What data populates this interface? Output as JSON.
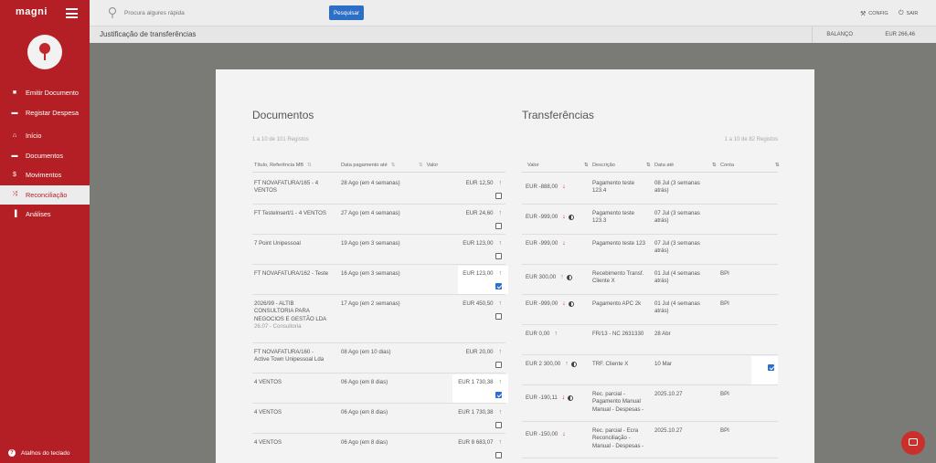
{
  "sidebar": {
    "brand": "magni",
    "groups": [
      {
        "items": [
          {
            "label": "Emitir Documento",
            "icon": "document-icon",
            "glyph": "■"
          },
          {
            "label": "Registar Despesa",
            "icon": "wallet-icon",
            "glyph": "▬"
          }
        ]
      },
      {
        "items": [
          {
            "label": "Início",
            "icon": "home-icon",
            "glyph": "⌂"
          },
          {
            "label": "Documentos",
            "icon": "folder-icon",
            "glyph": "▬"
          },
          {
            "label": "Movimentos",
            "icon": "dollar-icon",
            "glyph": "$"
          },
          {
            "label": "Reconciliação",
            "icon": "shuffle-icon",
            "glyph": "⤨",
            "active": true
          },
          {
            "label": "Análises",
            "icon": "bar-chart-icon",
            "glyph": "▐"
          }
        ]
      }
    ],
    "keyboard_shortcuts": "Atalhos do teclado"
  },
  "topbar": {
    "search_placeholder": "Procura algures rápida",
    "search_button": "Pesquisar",
    "config": "CONFIG",
    "logout": "SAIR"
  },
  "titlebar": {
    "title": "Justificação de transferências",
    "balance_label": "BALANÇO",
    "balance_value": "EUR 266,46"
  },
  "documents": {
    "title": "Documentos",
    "records": "1 a 10 de 101 Registos",
    "headers": [
      "Título, Referência MB",
      "Data pagamento até",
      "Valor"
    ],
    "rows": [
      {
        "title": [
          "FT NOVAFATURA/165 - 4",
          "VENTOS"
        ],
        "date": "28 Ago (em 4 semanas)",
        "value": "EUR 12,50",
        "checked": false
      },
      {
        "title": [
          "FT Testelnsert/1 - 4 VENTOS"
        ],
        "date": "27 Ago (em 4 semanas)",
        "value": "EUR 24,60",
        "checked": false
      },
      {
        "title": [
          "7 Point Unipessoal"
        ],
        "date": "19 Ago (em 3 semanas)",
        "value": "EUR 123,00",
        "checked": false
      },
      {
        "title": [
          "FT NOVAFATURA/162 - Teste"
        ],
        "date": "16 Ago (em 3 semanas)",
        "value": "EUR 123,00",
        "checked": true
      },
      {
        "title": [
          "2026/99 - ALTIB",
          "CONSULTORIA PARA",
          "NEGOCIOS E GESTÃO LDA",
          "26.07 - Consultoria"
        ],
        "date": "17 Ago (em 2 semanas)",
        "value": "EUR 450,50",
        "checked": false
      },
      {
        "title": [
          "FT NOVAFATURA/160 -",
          "Active Town Unipessoal Lda"
        ],
        "date": "08 Ago (em 10 dias)",
        "value": "EUR 20,00",
        "checked": false
      },
      {
        "title": [
          "4 VENTOS"
        ],
        "date": "06 Ago (em 8 dias)",
        "value": "EUR 1 730,38",
        "checked": true
      },
      {
        "title": [
          "4 VENTOS"
        ],
        "date": "06 Ago (em 8 dias)",
        "value": "EUR 1 730,38",
        "checked": false
      },
      {
        "title": [
          "4 VENTOS"
        ],
        "date": "06 Ago (em 8 dias)",
        "value": "EUR 8 683,07",
        "checked": false
      }
    ]
  },
  "transfers": {
    "title": "Transferências",
    "records": "1 a 10 de 82 Registos",
    "headers": [
      "Valor",
      "Descrição",
      "Data até",
      "Conta"
    ],
    "rows": [
      {
        "value": "EUR -888,00",
        "dir": "down",
        "half": false,
        "desc": [
          "Pagamento teste",
          "123.4"
        ],
        "date": [
          "08 Jul (3 semanas",
          "atrás)"
        ],
        "account": "",
        "checked": null
      },
      {
        "value": "EUR -999,00",
        "dir": "down",
        "half": true,
        "desc": [
          "Pagamento teste",
          "123.3"
        ],
        "date": [
          "07 Jul (3 semanas",
          "atrás)"
        ],
        "account": "",
        "checked": null
      },
      {
        "value": "EUR -999,00",
        "dir": "down",
        "half": false,
        "desc": [
          "Pagamento teste 123"
        ],
        "date": [
          "07 Jul (3 semanas",
          "atrás)"
        ],
        "account": "",
        "checked": null
      },
      {
        "value": "EUR 300,00",
        "dir": "up",
        "half": true,
        "desc": [
          "Recebimento Transf.",
          "Cliente X"
        ],
        "date": [
          "01 Jul (4 semanas",
          "atrás)"
        ],
        "account": "BPI",
        "checked": null
      },
      {
        "value": "EUR -999,00",
        "dir": "down",
        "half": true,
        "desc": [
          "Pagamento APC 2k"
        ],
        "date": [
          "01 Jul (4 semanas",
          "atrás)"
        ],
        "account": "BPI",
        "checked": null
      },
      {
        "value": "EUR 0,00",
        "dir": "up",
        "half": false,
        "desc": [
          "FR/13 - NC 2631330"
        ],
        "date": [
          "28 Abr"
        ],
        "account": "",
        "checked": null
      },
      {
        "value": "EUR 2 300,00",
        "dir": "up",
        "half": true,
        "desc": [
          "TRF. Cliente X"
        ],
        "date": [
          "10 Mar"
        ],
        "account": "",
        "checked": true
      },
      {
        "value": "EUR -190,11",
        "dir": "down",
        "half": true,
        "desc": [
          "Rec. parcial -",
          "Pagamento Manual",
          "Manual - Despesas -"
        ],
        "date": [
          "2025.10.27"
        ],
        "account": "BPI",
        "checked": null
      },
      {
        "value": "EUR -150,00",
        "dir": "down",
        "half": false,
        "desc": [
          "Rec. parcial - Ecra",
          "Reconciliação -",
          "Manual - Despesas -"
        ],
        "date": [
          "2025.10.27"
        ],
        "account": "BPI",
        "checked": null
      }
    ]
  }
}
